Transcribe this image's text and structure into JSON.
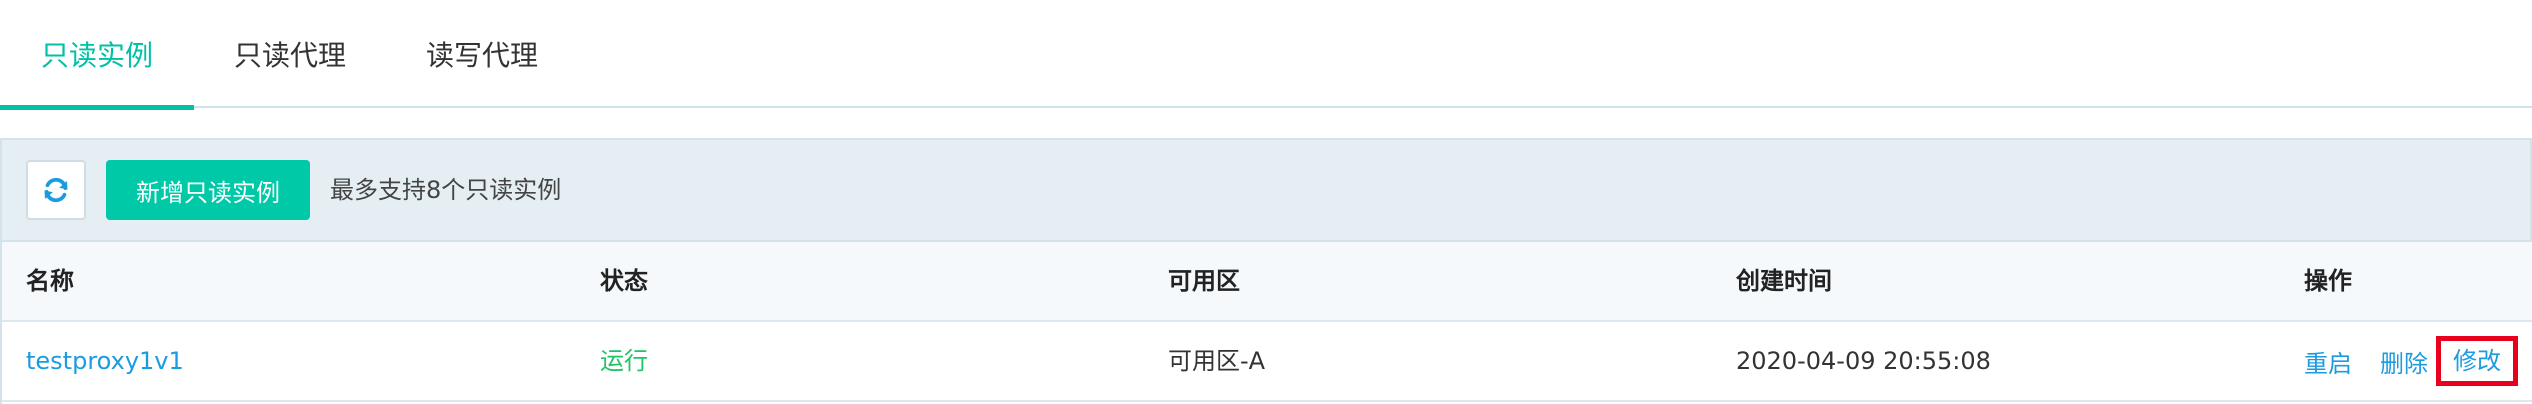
{
  "tabs": [
    {
      "label": "只读实例",
      "active": true
    },
    {
      "label": "只读代理",
      "active": false
    },
    {
      "label": "读写代理",
      "active": false
    }
  ],
  "toolbar": {
    "refresh_icon": "refresh-icon",
    "add_label": "新增只读实例",
    "hint": "最多支持8个只读实例"
  },
  "table": {
    "columns": [
      "名称",
      "状态",
      "可用区",
      "创建时间",
      "操作"
    ],
    "rows": [
      {
        "name": "testproxy1v1",
        "status": "运行",
        "zone": "可用区-A",
        "created": "2020-04-09 20:55:08",
        "actions": [
          "重启",
          "删除",
          "修改"
        ]
      }
    ]
  },
  "colors": {
    "accent": "#00c1a6",
    "primary_button": "#00c9a7",
    "link": "#1b9be0",
    "status_running": "#1fc36b",
    "highlight_box": "#e8001c",
    "toolbar_bg": "#e4eef3"
  }
}
